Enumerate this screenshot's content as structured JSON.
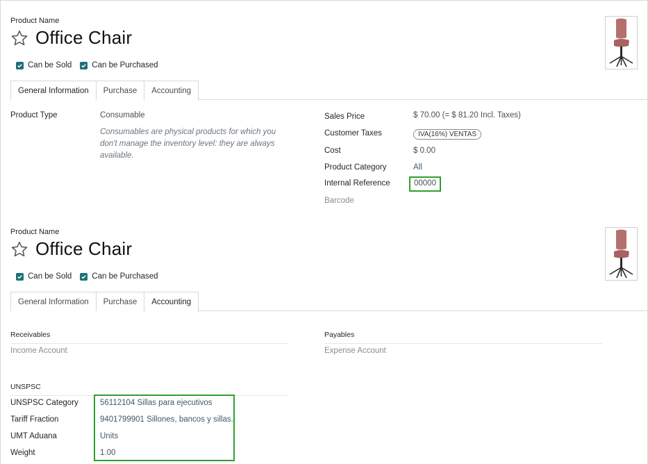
{
  "panel1": {
    "product_name_label": "Product Name",
    "title": "Office Chair",
    "can_be_sold": "Can be Sold",
    "can_be_purchased": "Can be Purchased",
    "tabs": [
      {
        "label": "General Information",
        "active": true
      },
      {
        "label": "Purchase",
        "active": false
      },
      {
        "label": "Accounting",
        "active": false
      }
    ],
    "product_type_label": "Product Type",
    "product_type_value": "Consumable",
    "product_type_help": "Consumables are physical products for which you don't manage the inventory level: they are always available.",
    "sales_price_label": "Sales Price",
    "sales_price_value": "$ 70.00  (= $ 81.20 Incl. Taxes)",
    "customer_taxes_label": "Customer Taxes",
    "customer_taxes_tag": "IVA(16%) VENTAS",
    "cost_label": "Cost",
    "cost_value": "$ 0.00",
    "category_label": "Product Category",
    "category_value": "All",
    "internal_ref_label": "Internal Reference",
    "internal_ref_value": "00000",
    "barcode_label": "Barcode"
  },
  "panel2": {
    "product_name_label": "Product Name",
    "title": "Office Chair",
    "can_be_sold": "Can be Sold",
    "can_be_purchased": "Can be Purchased",
    "tabs": [
      {
        "label": "General Information",
        "active": false
      },
      {
        "label": "Purchase",
        "active": false
      },
      {
        "label": "Accounting",
        "active": true
      }
    ],
    "receivables_head": "Receivables",
    "income_account_label": "Income Account",
    "payables_head": "Payables",
    "expense_account_label": "Expense Account",
    "unspsc_head": "UNSPSC",
    "unspsc_category_label": "UNSPSC Category",
    "unspsc_category_value": "56112104 Sillas para ejecutivos",
    "tariff_label": "Tariff Fraction",
    "tariff_value": "9401799901 Sillones, bancos y sillas.",
    "umt_label": "UMT Aduana",
    "umt_value": "Units",
    "weight_label": "Weight",
    "weight_value": "1.00"
  },
  "colors": {
    "checkbox": "#1f6f78",
    "highlight": "#2ca02c",
    "chair_seat": "#b5706e"
  }
}
